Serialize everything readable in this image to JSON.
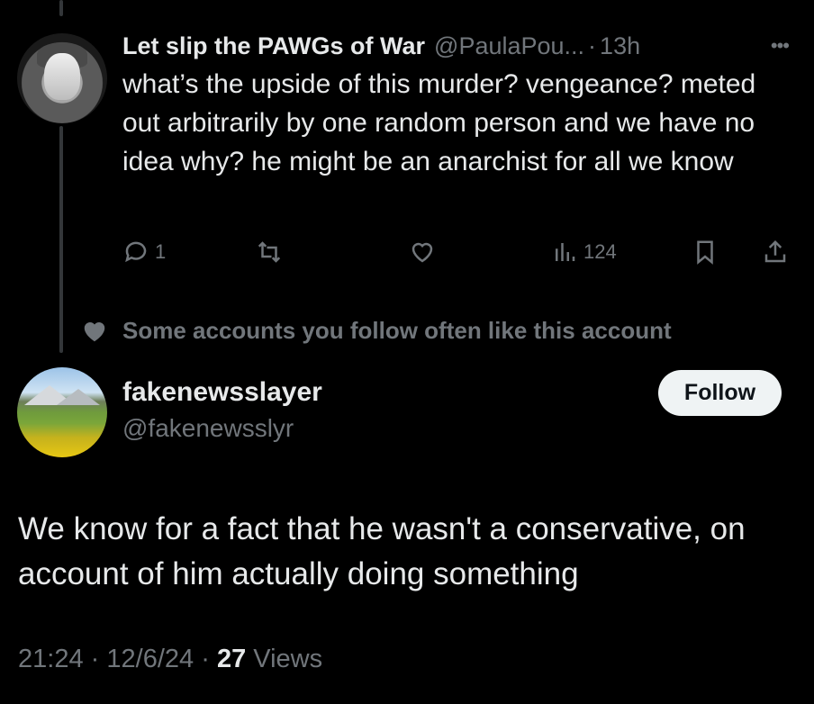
{
  "tweet1": {
    "author_name": "Let slip the PAWGs of War",
    "author_handle": "@PaulaPou...",
    "separator": "·",
    "time": "13h",
    "text": "what’s the upside of this murder? vengeance? meted out arbitrarily by one random person and we have no idea why? he might be an anarchist for all we know",
    "actions": {
      "replies": "1",
      "views": "124"
    }
  },
  "social_context": {
    "text": "Some accounts you follow often like this account"
  },
  "tweet2": {
    "author_name": "fakenewsslayer",
    "author_handle": "@fakenewsslyr",
    "follow_label": "Follow",
    "text": "We know for a fact that he wasn't a conservative, on account of him actually doing something",
    "meta": {
      "time": "21:24",
      "sep1": "·",
      "date": "12/6/24",
      "sep2": "·",
      "views_count": "27",
      "views_label": "Views"
    }
  },
  "icons": [
    "more-icon",
    "reply-icon",
    "retweet-icon",
    "like-icon",
    "views-icon",
    "bookmark-icon",
    "share-icon",
    "heart-icon"
  ]
}
